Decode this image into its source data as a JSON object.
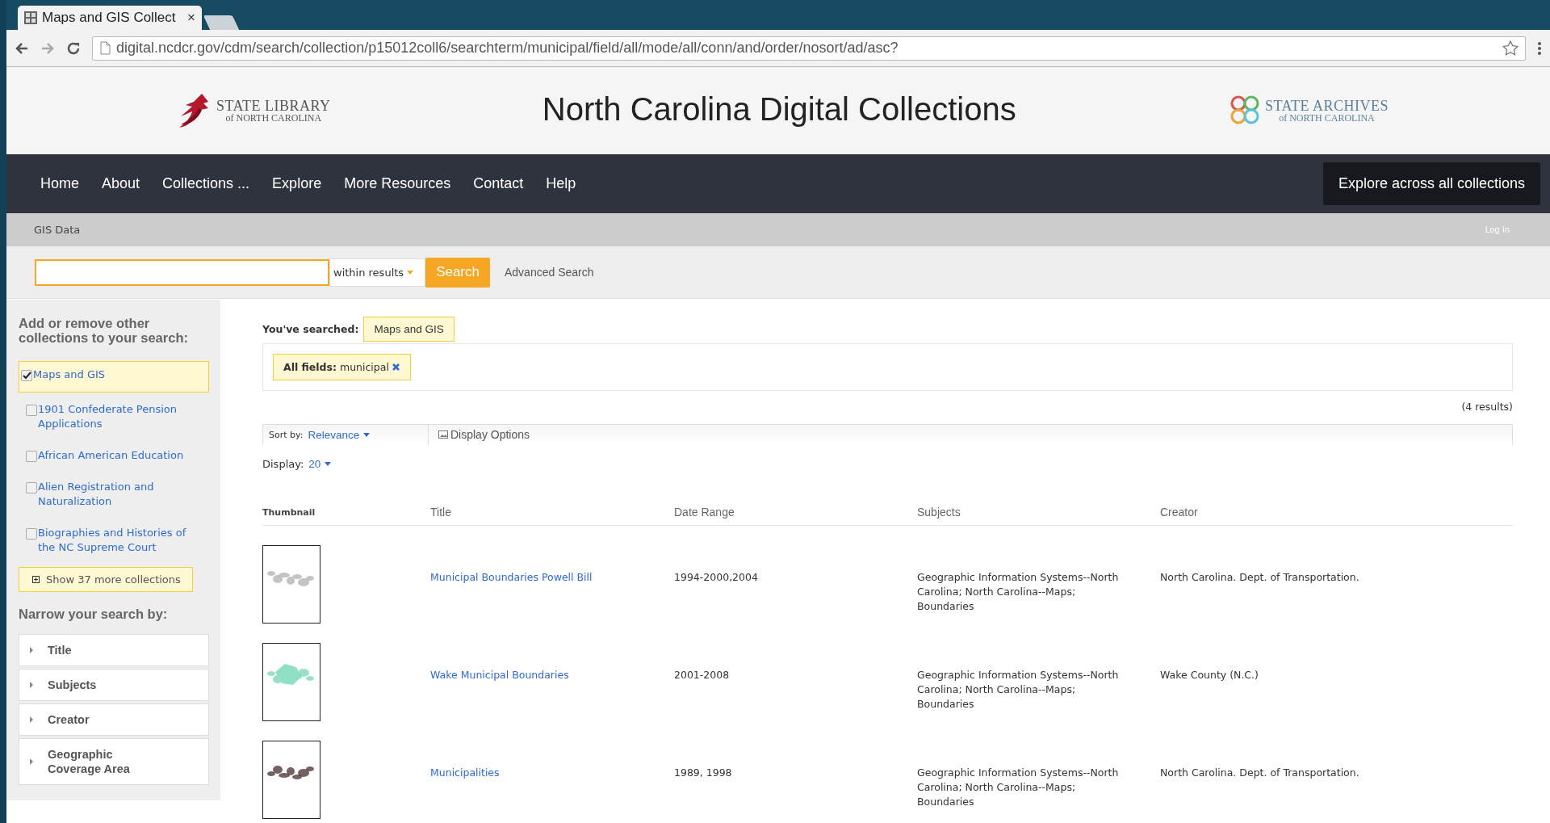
{
  "browser": {
    "tab": {
      "title": "Maps and GIS Collect",
      "close": "×"
    },
    "url": "digital.ncdcr.gov/cdm/search/collection/p15012coll6/searchterm/municipal/field/all/mode/all/conn/and/order/nosort/ad/asc?"
  },
  "header": {
    "left_logo": {
      "name": "STATE LIBRARY",
      "sub": "of NORTH CAROLINA"
    },
    "title": "North Carolina Digital Collections",
    "right_logo": {
      "name": "STATE ARCHIVES",
      "sub": "of NORTH CAROLINA"
    }
  },
  "nav": {
    "items": [
      "Home",
      "About",
      "Collections ...",
      "Explore",
      "More Resources",
      "Contact",
      "Help"
    ],
    "button": "Explore across all collections"
  },
  "breadcrumb": {
    "current": "GIS Data",
    "login": "Log in"
  },
  "search": {
    "scope": "within results",
    "button": "Search",
    "advanced": "Advanced Search"
  },
  "sidebar": {
    "collections_heading": "Add or remove other collections to your search:",
    "collections": [
      {
        "label": "Maps and GIS",
        "checked": true
      },
      {
        "label": "1901 Confederate Pension Applications",
        "checked": false
      },
      {
        "label": "African American Education",
        "checked": false
      },
      {
        "label": "Alien Registration and Naturalization",
        "checked": false
      },
      {
        "label": "Biographies and Histories of the NC Supreme Court",
        "checked": false
      }
    ],
    "more_button": "Show 37 more collections",
    "narrow_heading": "Narrow your search by:",
    "facets": [
      {
        "label": "Title",
        "expanded": false
      },
      {
        "label": "Subjects",
        "expanded": false
      },
      {
        "label": "Creator",
        "expanded": false
      },
      {
        "label": "Geographic Coverage Area",
        "expanded": false
      }
    ]
  },
  "results": {
    "searched_label": "You've searched:",
    "searched_collection": "Maps and GIS",
    "filters": [
      "**All fields:** municipal"
    ],
    "count": "(4 results)",
    "sort_label": "Sort by:",
    "sort_value": "Relevance",
    "display_options": "Display Options",
    "display_label": "Display:",
    "display_value": "20",
    "columns": [
      "Thumbnail",
      "Title",
      "Date Range",
      "Subjects",
      "Creator"
    ],
    "rows": [
      {
        "title": "Municipal Boundaries Powell Bill",
        "date_range": "1994-2000,2004",
        "subjects": "Geographic Information Systems--North Carolina; North Carolina--Maps; Boundaries",
        "creator": "North Carolina. Dept. of Transportation."
      },
      {
        "title": "Wake Municipal Boundaries",
        "date_range": "2001-2008",
        "subjects": "Geographic Information Systems--North Carolina; North Carolina--Maps; Boundaries",
        "creator": "Wake County (N.C.)"
      },
      {
        "title": "Municipalities",
        "date_range": "1989, 1998",
        "subjects": "Geographic Information Systems--North Carolina; North Carolina--Maps; Boundaries",
        "creator": "North Carolina. Dept. of Transportation."
      }
    ]
  }
}
